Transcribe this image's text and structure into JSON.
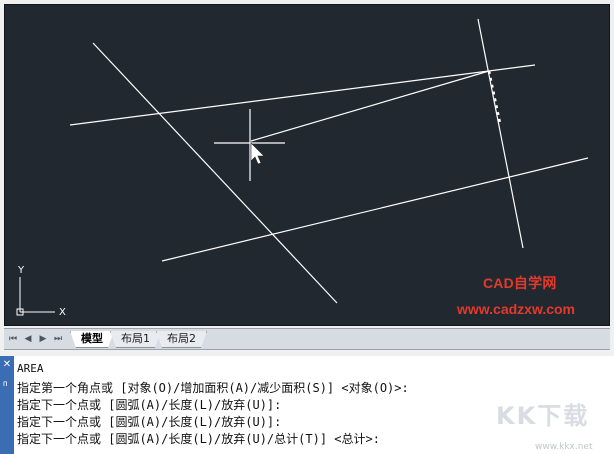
{
  "drawing": {
    "ucs_y_label": "Y",
    "ucs_x_label": "X",
    "watermark_site": "CAD自学网",
    "watermark_url": "www.cadzxw.com",
    "line_color": "#ffffff",
    "watermark_color": "#e23a2b",
    "background_color": "#212830"
  },
  "tabs": {
    "nav": [
      "⏮",
      "◀",
      "▶",
      "⏭"
    ],
    "items": [
      {
        "label": "模型",
        "active": true
      },
      {
        "label": "布局1",
        "active": false
      },
      {
        "label": "布局2",
        "active": false
      }
    ]
  },
  "command": {
    "side_close": "✕",
    "side_pin": "ᴨ",
    "lines": [
      "AREA",
      "指定第一个角点或 [对象(O)/增加面积(A)/减少面积(S)] <对象(O)>:",
      "指定下一个点或 [圆弧(A)/长度(L)/放弃(U)]:",
      "指定下一个点或 [圆弧(A)/长度(L)/放弃(U)]:",
      "指定下一个点或 [圆弧(A)/长度(L)/放弃(U)/总计(T)] <总计>:"
    ]
  },
  "overlay": {
    "logo": "KK下载",
    "url": "www.kkx.net"
  }
}
